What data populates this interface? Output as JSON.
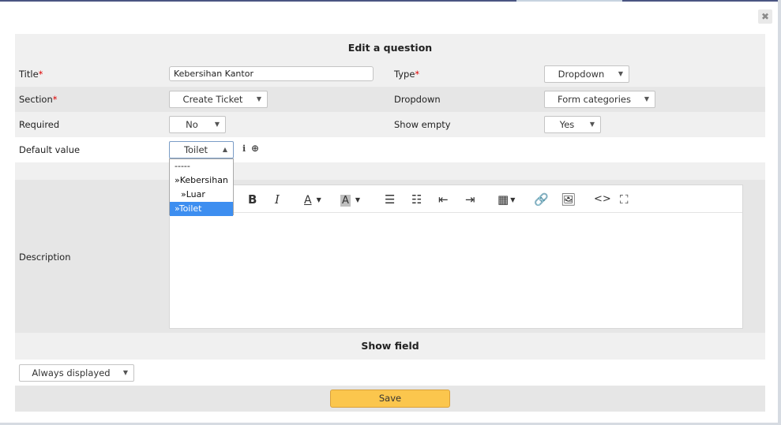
{
  "dialog": {
    "header_title": "Edit a question",
    "close_glyph": "✖"
  },
  "form": {
    "title_label": "Title",
    "title_value": "Kebersihan Kantor",
    "type_label": "Type",
    "type_value": "Dropdown",
    "section_label": "Section",
    "section_value": "Create Ticket",
    "dropdown_label": "Dropdown",
    "dropdown_value": "Form categories",
    "required_label": "Required",
    "required_value": "No",
    "show_empty_label": "Show empty",
    "show_empty_value": "Yes",
    "default_value_label": "Default value",
    "default_value": "Toilet",
    "description_label": "Description",
    "required_marker": "*"
  },
  "default_options": [
    "-----",
    "»Kebersihan",
    "  »Luar",
    "»Toilet"
  ],
  "show_field": {
    "header": "Show field",
    "value": "Always displayed"
  },
  "save_label": "Save",
  "toolbar_glyphs": {
    "bold": "B",
    "italic": "I",
    "font_color": "A",
    "bg_color": "A"
  },
  "colors": {
    "accent_save": "#fbc64d",
    "selected_option": "#3d8ef0",
    "required": "#dd0000"
  }
}
